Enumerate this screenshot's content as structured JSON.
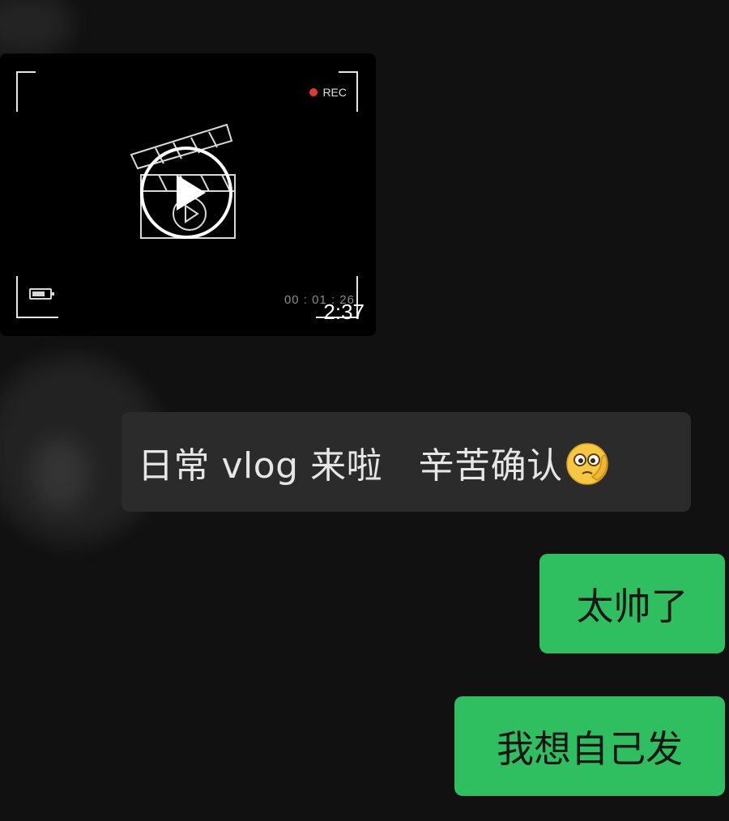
{
  "messages": {
    "video": {
      "rec_label": "REC",
      "timecode": "00 : 01 : 26",
      "duration": "2:37"
    },
    "incoming": {
      "text": "日常 vlog 来啦　辛苦确认",
      "emoji": "thinking-face-icon"
    },
    "outgoing": [
      {
        "text": "太帅了"
      },
      {
        "text": "我想自己发"
      }
    ]
  },
  "colors": {
    "background": "#111111",
    "incoming_bubble": "#2b2b2b",
    "outgoing_bubble": "#2fbf60",
    "rec_dot": "#e53935"
  }
}
